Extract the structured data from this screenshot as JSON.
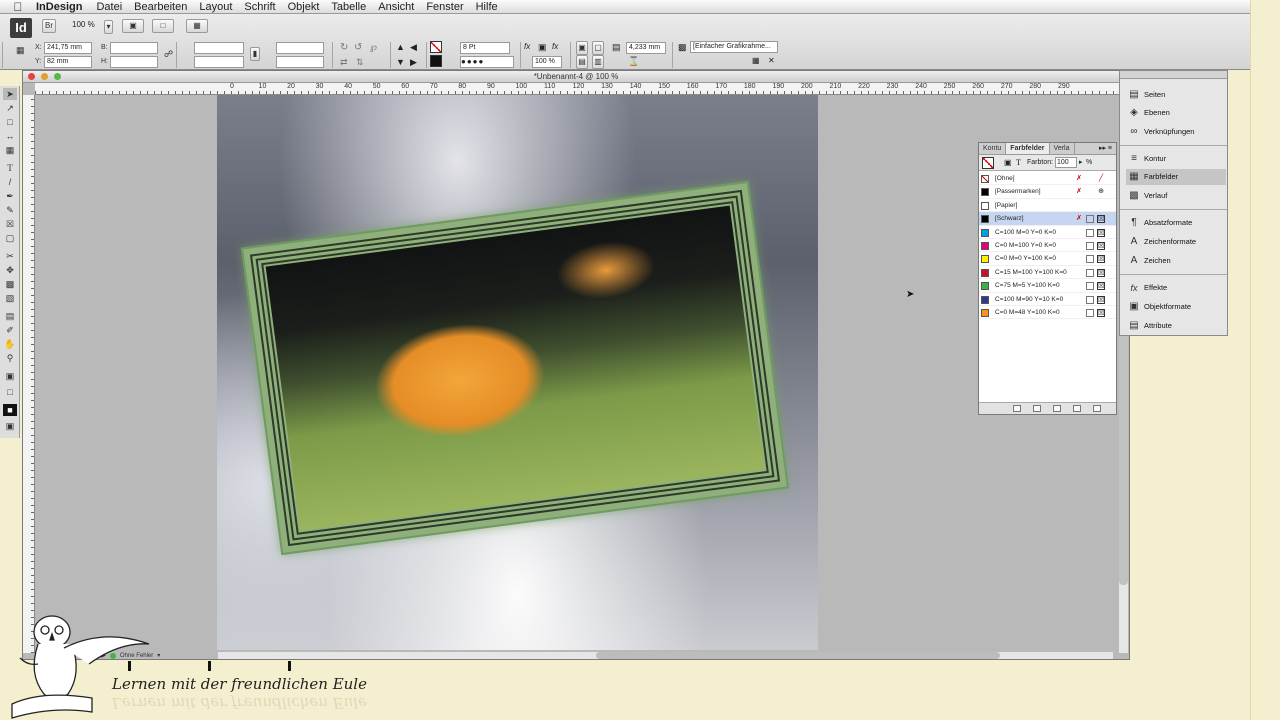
{
  "menubar": {
    "app_name": "InDesign",
    "items": [
      "Datei",
      "Bearbeiten",
      "Layout",
      "Schrift",
      "Objekt",
      "Tabelle",
      "Ansicht",
      "Fenster",
      "Hilfe"
    ]
  },
  "control_bar": {
    "app_icon": "Id",
    "bridge_label": "Br",
    "zoom_value": "100 %",
    "x_label": "X:",
    "x_value": "241,75 mm",
    "y_label": "Y:",
    "y_value": "82 mm",
    "b_label": "B:",
    "h_label": "H:",
    "stroke_weight": "8 Pt",
    "percent_value": "100 %",
    "offset_value": "4,233 mm",
    "frame_type": "[Einfacher Grafikrahme..."
  },
  "document": {
    "title": "*Unbenannt-4 @ 100 %",
    "ruler_labels": [
      "0",
      "10",
      "20",
      "30",
      "40",
      "50",
      "60",
      "70",
      "80",
      "90",
      "100",
      "110",
      "120",
      "130",
      "140",
      "150",
      "160",
      "170",
      "180",
      "190",
      "200",
      "210",
      "220",
      "230",
      "240",
      "250",
      "260",
      "270",
      "280",
      "290"
    ],
    "preflight_status": "Ohne Fehler"
  },
  "swatches_panel": {
    "tabs": [
      "Kontu",
      "Farbfelder",
      "Verla"
    ],
    "tint_label": "Farbton:",
    "tint_value": "100",
    "tint_unit": "%",
    "rows": [
      {
        "name": "[Ohne]",
        "color": "#ffffff"
      },
      {
        "name": "[Passermarken]",
        "color": "#000000"
      },
      {
        "name": "[Papier]",
        "color": "#ffffff"
      },
      {
        "name": "[Schwarz]",
        "color": "#000000"
      },
      {
        "name": "C=100 M=0 Y=0 K=0",
        "color": "#00a0e0"
      },
      {
        "name": "C=0 M=100 Y=0 K=0",
        "color": "#e6007e"
      },
      {
        "name": "C=0 M=0 Y=100 K=0",
        "color": "#fff200"
      },
      {
        "name": "C=15 M=100 Y=100 K=0",
        "color": "#c8102e"
      },
      {
        "name": "C=75 M=5 Y=100 K=0",
        "color": "#3fae49"
      },
      {
        "name": "C=100 M=90 Y=10 K=0",
        "color": "#2b3990"
      },
      {
        "name": "C=0 M=48 Y=100 K=0",
        "color": "#f7941d"
      }
    ]
  },
  "dock": {
    "items": [
      "Seiten",
      "Ebenen",
      "Verknüpfungen",
      "Kontur",
      "Farbfelder",
      "Verlauf",
      "Absatzformate",
      "Zeichenformate",
      "Zeichen",
      "Effekte",
      "Objektformate",
      "Attribute"
    ],
    "active": "Farbfelder"
  },
  "caption": "Lernen mit der freundlichen Eule"
}
